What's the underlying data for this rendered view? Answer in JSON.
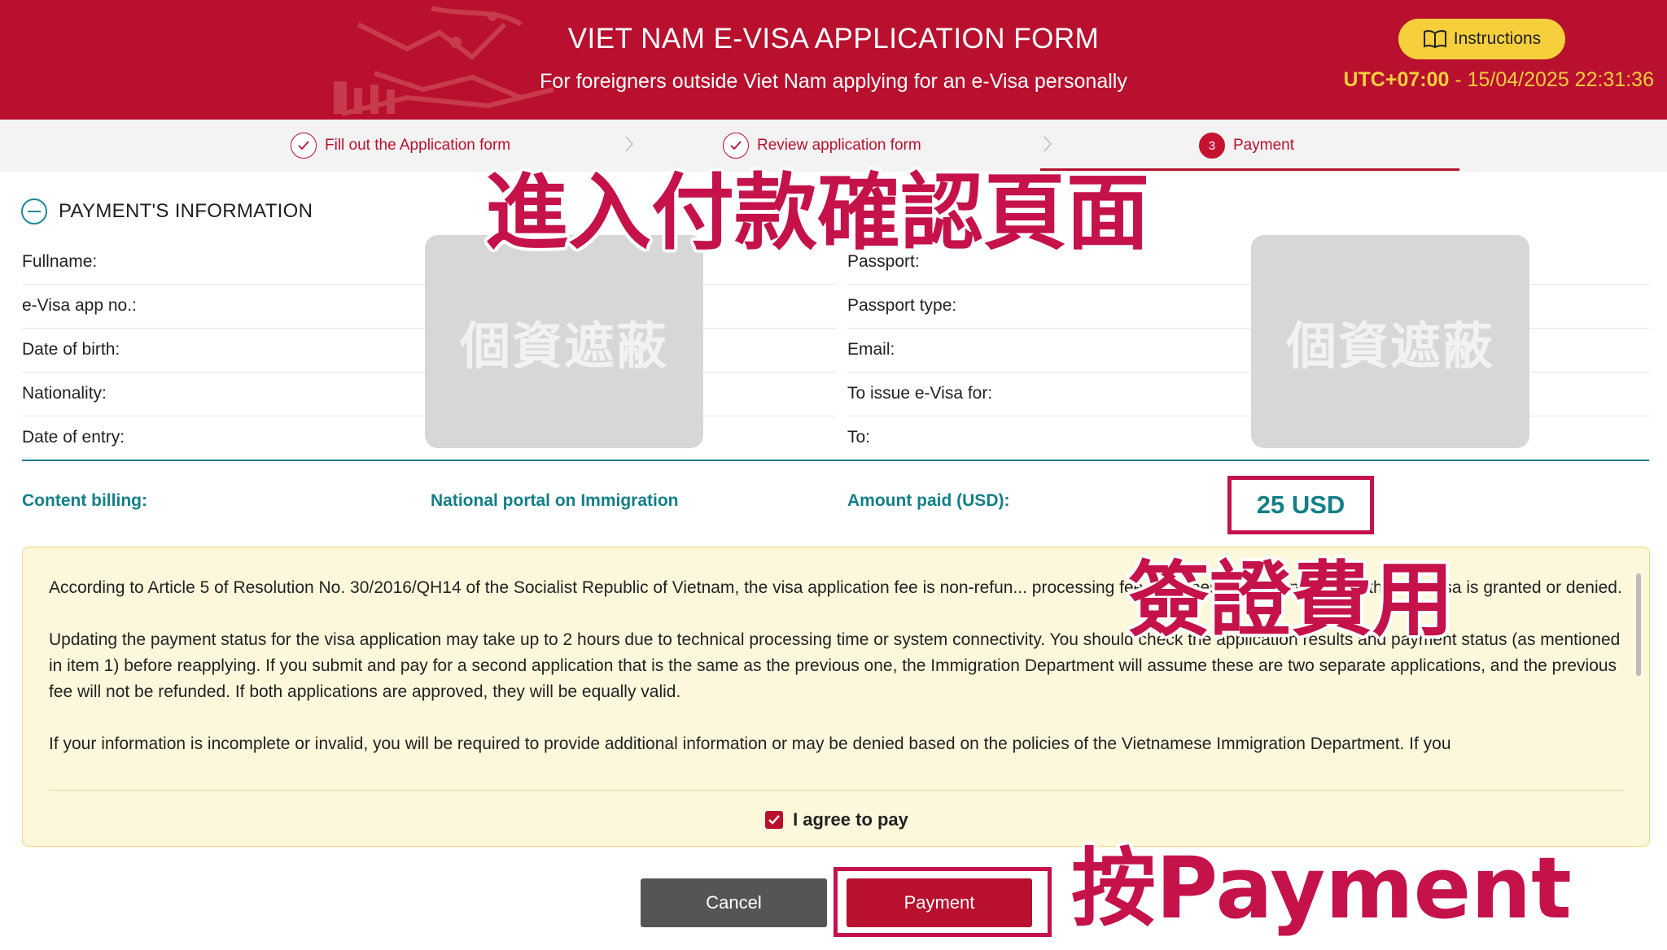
{
  "header": {
    "title": "VIET NAM E-VISA APPLICATION FORM",
    "subtitle": "For foreigners outside Viet Nam applying for an e-Visa personally",
    "instructions_label": "Instructions",
    "timezone": "UTC+07:00",
    "datetime": " - 15/04/2025 22:31:36",
    "bg_color": "#b8102e",
    "accent_color": "#f7cf3d"
  },
  "stepper": {
    "steps": [
      {
        "label": "Fill out the Application form",
        "state": "done",
        "icon": "check-icon"
      },
      {
        "label": "Review application form",
        "state": "done",
        "icon": "check-icon"
      },
      {
        "label": "Payment",
        "state": "active",
        "number": "3"
      }
    ]
  },
  "payment_info": {
    "title": "PAYMENT'S INFORMATION",
    "left_fields": [
      "Fullname:",
      "e-Visa app no.:",
      "Date of birth:",
      "Nationality:",
      "Date of entry:"
    ],
    "right_fields": [
      "Passport:",
      "Passport type:",
      "Email:",
      "To issue e-Visa for:",
      "To:"
    ],
    "redaction_label": "個資遮蔽"
  },
  "billing": {
    "content_label": "Content billing:",
    "content_value": "National portal on Immigration",
    "amount_label": "Amount paid (USD):",
    "amount_value": "25 USD"
  },
  "notice": {
    "paragraphs": [
      "According to Article 5 of Resolution No. 30/2016/QH14 of the Socialist Republic of Vietnam, the visa application fee is non-refun... processing fee and does not depend on whether the visa is granted or denied.",
      "Updating the payment status for the visa application may take up to 2 hours due to technical processing time or system connectivity. You should check the application results and payment status (as mentioned in item 1) before reapplying. If you submit and pay for a second application that is the same as the previous one, the Immigration Department will assume these are two separate applications, and the previous fee will not be refunded. If both applications are approved, they will be equally valid.",
      "If your information is incomplete or invalid, you will be required to provide additional information or may be denied based on the policies of the Vietnamese Immigration Department. If you"
    ],
    "agree_label": "I agree to pay",
    "agree_checked": true
  },
  "actions": {
    "cancel_label": "Cancel",
    "payment_label": "Payment"
  },
  "annotations": {
    "confirm_page": "進入付款確認頁面",
    "visa_fee": "簽證費用",
    "press_payment": "按Payment",
    "color": "#c5124a"
  }
}
